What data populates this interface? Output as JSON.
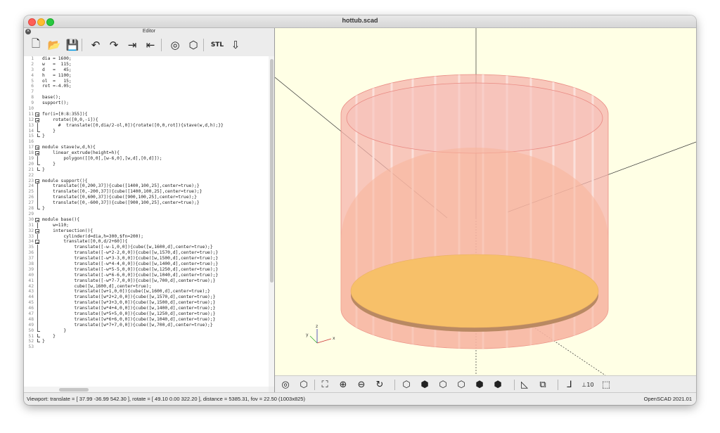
{
  "window": {
    "title": "hottub.scad"
  },
  "editor": {
    "title": "Editor",
    "toolbar": [
      {
        "icon": "new-file-icon",
        "glyph": "🗋"
      },
      {
        "icon": "open-folder-icon",
        "glyph": "📂"
      },
      {
        "icon": "save-icon",
        "glyph": "💾"
      },
      {
        "icon": "undo-icon",
        "glyph": "↶"
      },
      {
        "icon": "redo-icon",
        "glyph": "↷"
      },
      {
        "icon": "indent-icon",
        "glyph": "⇥"
      },
      {
        "icon": "unindent-icon",
        "glyph": "⇤"
      },
      {
        "icon": "preview-icon",
        "glyph": "◎"
      },
      {
        "icon": "render-icon",
        "glyph": "⬡"
      },
      {
        "icon": "export-stl-icon",
        "glyph": "STL"
      },
      {
        "icon": "send-to-print-icon",
        "glyph": "⇩"
      }
    ],
    "code_lines": [
      {
        "n": "1",
        "fold": "",
        "text": "dia = 1600;"
      },
      {
        "n": "2",
        "fold": "",
        "text": "w   =  115;"
      },
      {
        "n": "3",
        "fold": "",
        "text": "d   =   45;"
      },
      {
        "n": "4",
        "fold": "",
        "text": "h   = 1100;"
      },
      {
        "n": "5",
        "fold": "",
        "text": "ol  =   15;"
      },
      {
        "n": "6",
        "fold": "",
        "text": "rot =-4.05;"
      },
      {
        "n": "7",
        "fold": "",
        "text": ""
      },
      {
        "n": "8",
        "fold": "",
        "text": "base();"
      },
      {
        "n": "9",
        "fold": "",
        "text": "support();"
      },
      {
        "n": "10",
        "fold": "",
        "text": ""
      },
      {
        "n": "11",
        "fold": "box",
        "text": "for(i=[0:8:355]){"
      },
      {
        "n": "12",
        "fold": "box",
        "text": "    rotate([0,0,-i]){"
      },
      {
        "n": "13",
        "fold": "bar",
        "text": "      #  translate([0,dia/2-ol,0]){rotate([0,0,rot]){stave(w,d,h);}}"
      },
      {
        "n": "14",
        "fold": "end",
        "text": "    }"
      },
      {
        "n": "15",
        "fold": "end",
        "text": "}"
      },
      {
        "n": "16",
        "fold": "",
        "text": ""
      },
      {
        "n": "17",
        "fold": "box",
        "text": "module stave(w,d,h){"
      },
      {
        "n": "18",
        "fold": "box",
        "text": "    linear_extrude(height=h){"
      },
      {
        "n": "19",
        "fold": "bar",
        "text": "        polygon([[0,0],[w-6,0],[w,d],[0,d]]);"
      },
      {
        "n": "20",
        "fold": "end",
        "text": "    }"
      },
      {
        "n": "21",
        "fold": "end",
        "text": "}"
      },
      {
        "n": "22",
        "fold": "",
        "text": ""
      },
      {
        "n": "23",
        "fold": "box",
        "text": "module support(){"
      },
      {
        "n": "24",
        "fold": "bar",
        "text": "    translate([0,200,37]){cube([1400,100,25],center=true);}"
      },
      {
        "n": "25",
        "fold": "bar",
        "text": "    translate([0,-200,37]){cube([1400,100,25],center=true);}"
      },
      {
        "n": "26",
        "fold": "bar",
        "text": "    translate([0,600,37]){cube([900,100,25],center=true);}"
      },
      {
        "n": "27",
        "fold": "bar",
        "text": "    translate([0,-600,37]){cube([900,100,25],center=true);}"
      },
      {
        "n": "28",
        "fold": "end",
        "text": "}"
      },
      {
        "n": "29",
        "fold": "",
        "text": ""
      },
      {
        "n": "30",
        "fold": "box",
        "text": "module base(){"
      },
      {
        "n": "31",
        "fold": "bar",
        "text": "    w=110;"
      },
      {
        "n": "32",
        "fold": "box",
        "text": "    intersection(){"
      },
      {
        "n": "33",
        "fold": "bar",
        "text": "        cylinder(d=dia,h=300,$fn=200);"
      },
      {
        "n": "34",
        "fold": "box",
        "text": "        translate([0,0,d/2+60]){"
      },
      {
        "n": "35",
        "fold": "bar",
        "text": "            translate([-w-1,0,0]){cube([w,1600,d],center=true);}"
      },
      {
        "n": "36",
        "fold": "bar",
        "text": "            translate([-w*2-2,0,0]){cube([w,1570,d],center=true);}"
      },
      {
        "n": "37",
        "fold": "bar",
        "text": "            translate([-w*3-3,0,0]){cube([w,1500,d],center=true);}"
      },
      {
        "n": "38",
        "fold": "bar",
        "text": "            translate([-w*4-4,0,0]){cube([w,1400,d],center=true);}"
      },
      {
        "n": "39",
        "fold": "bar",
        "text": "            translate([-w*5-5,0,0]){cube([w,1250,d],center=true);}"
      },
      {
        "n": "40",
        "fold": "bar",
        "text": "            translate([-w*6-6,0,0]){cube([w,1040,d],center=true);}"
      },
      {
        "n": "41",
        "fold": "bar",
        "text": "            translate([-w*7-7,0,0]){cube([w,700,d],center=true);}"
      },
      {
        "n": "42",
        "fold": "bar",
        "text": "            cube([w,1600,d],center=true);"
      },
      {
        "n": "43",
        "fold": "bar",
        "text": "            translate([w+1,0,0]){cube([w,1600,d],center=true);}"
      },
      {
        "n": "44",
        "fold": "bar",
        "text": "            translate([w*2+2,0,0]){cube([w,1570,d],center=true);}"
      },
      {
        "n": "45",
        "fold": "bar",
        "text": "            translate([w*3+3,0,0]){cube([w,1500,d],center=true);}"
      },
      {
        "n": "46",
        "fold": "bar",
        "text": "            translate([w*4+4,0,0]){cube([w,1400,d],center=true);}"
      },
      {
        "n": "47",
        "fold": "bar",
        "text": "            translate([w*5+5,0,0]){cube([w,1250,d],center=true);}"
      },
      {
        "n": "48",
        "fold": "bar",
        "text": "            translate([w*6+6,0,0]){cube([w,1040,d],center=true);}"
      },
      {
        "n": "49",
        "fold": "bar",
        "text": "            translate([w*7+7,0,0]){cube([w,700,d],center=true);}"
      },
      {
        "n": "50",
        "fold": "end",
        "text": "        }"
      },
      {
        "n": "51",
        "fold": "end",
        "text": "    }"
      },
      {
        "n": "52",
        "fold": "end",
        "text": "}"
      },
      {
        "n": "53",
        "fold": "",
        "text": ""
      }
    ]
  },
  "viewer": {
    "axis_labels": {
      "x": "x",
      "y": "y",
      "z": "z"
    },
    "toolbar": [
      {
        "icon": "preview-icon",
        "glyph": "◎"
      },
      {
        "icon": "render-icon",
        "glyph": "⬡"
      },
      {
        "icon": "view-all-icon",
        "glyph": "⛶"
      },
      {
        "icon": "zoom-in-icon",
        "glyph": "⊕"
      },
      {
        "icon": "zoom-out-icon",
        "glyph": "⊖"
      },
      {
        "icon": "reset-view-icon",
        "glyph": "↻"
      },
      {
        "icon": "view-right-icon",
        "glyph": "⬡"
      },
      {
        "icon": "view-top-icon",
        "glyph": "⬢"
      },
      {
        "icon": "view-bottom-icon",
        "glyph": "⬡"
      },
      {
        "icon": "view-left-icon",
        "glyph": "⬡"
      },
      {
        "icon": "view-front-icon",
        "glyph": "⬢"
      },
      {
        "icon": "view-back-icon",
        "glyph": "⬢"
      },
      {
        "icon": "perspective-icon",
        "glyph": "◺"
      },
      {
        "icon": "orthogonal-icon",
        "glyph": "⧉"
      },
      {
        "icon": "show-axes-icon",
        "glyph": "⅃"
      },
      {
        "icon": "show-scale-markers-icon",
        "glyph": "⊥10"
      },
      {
        "icon": "show-edges-icon",
        "glyph": "⬚"
      }
    ]
  },
  "status": {
    "viewport": "Viewport: translate = [ 37.99 -36.99 542.30 ], rotate = [ 49.10 0.00 322.20 ], distance = 5385.31, fov = 22.50 (1003x825)",
    "version": "OpenSCAD 2021.01"
  }
}
